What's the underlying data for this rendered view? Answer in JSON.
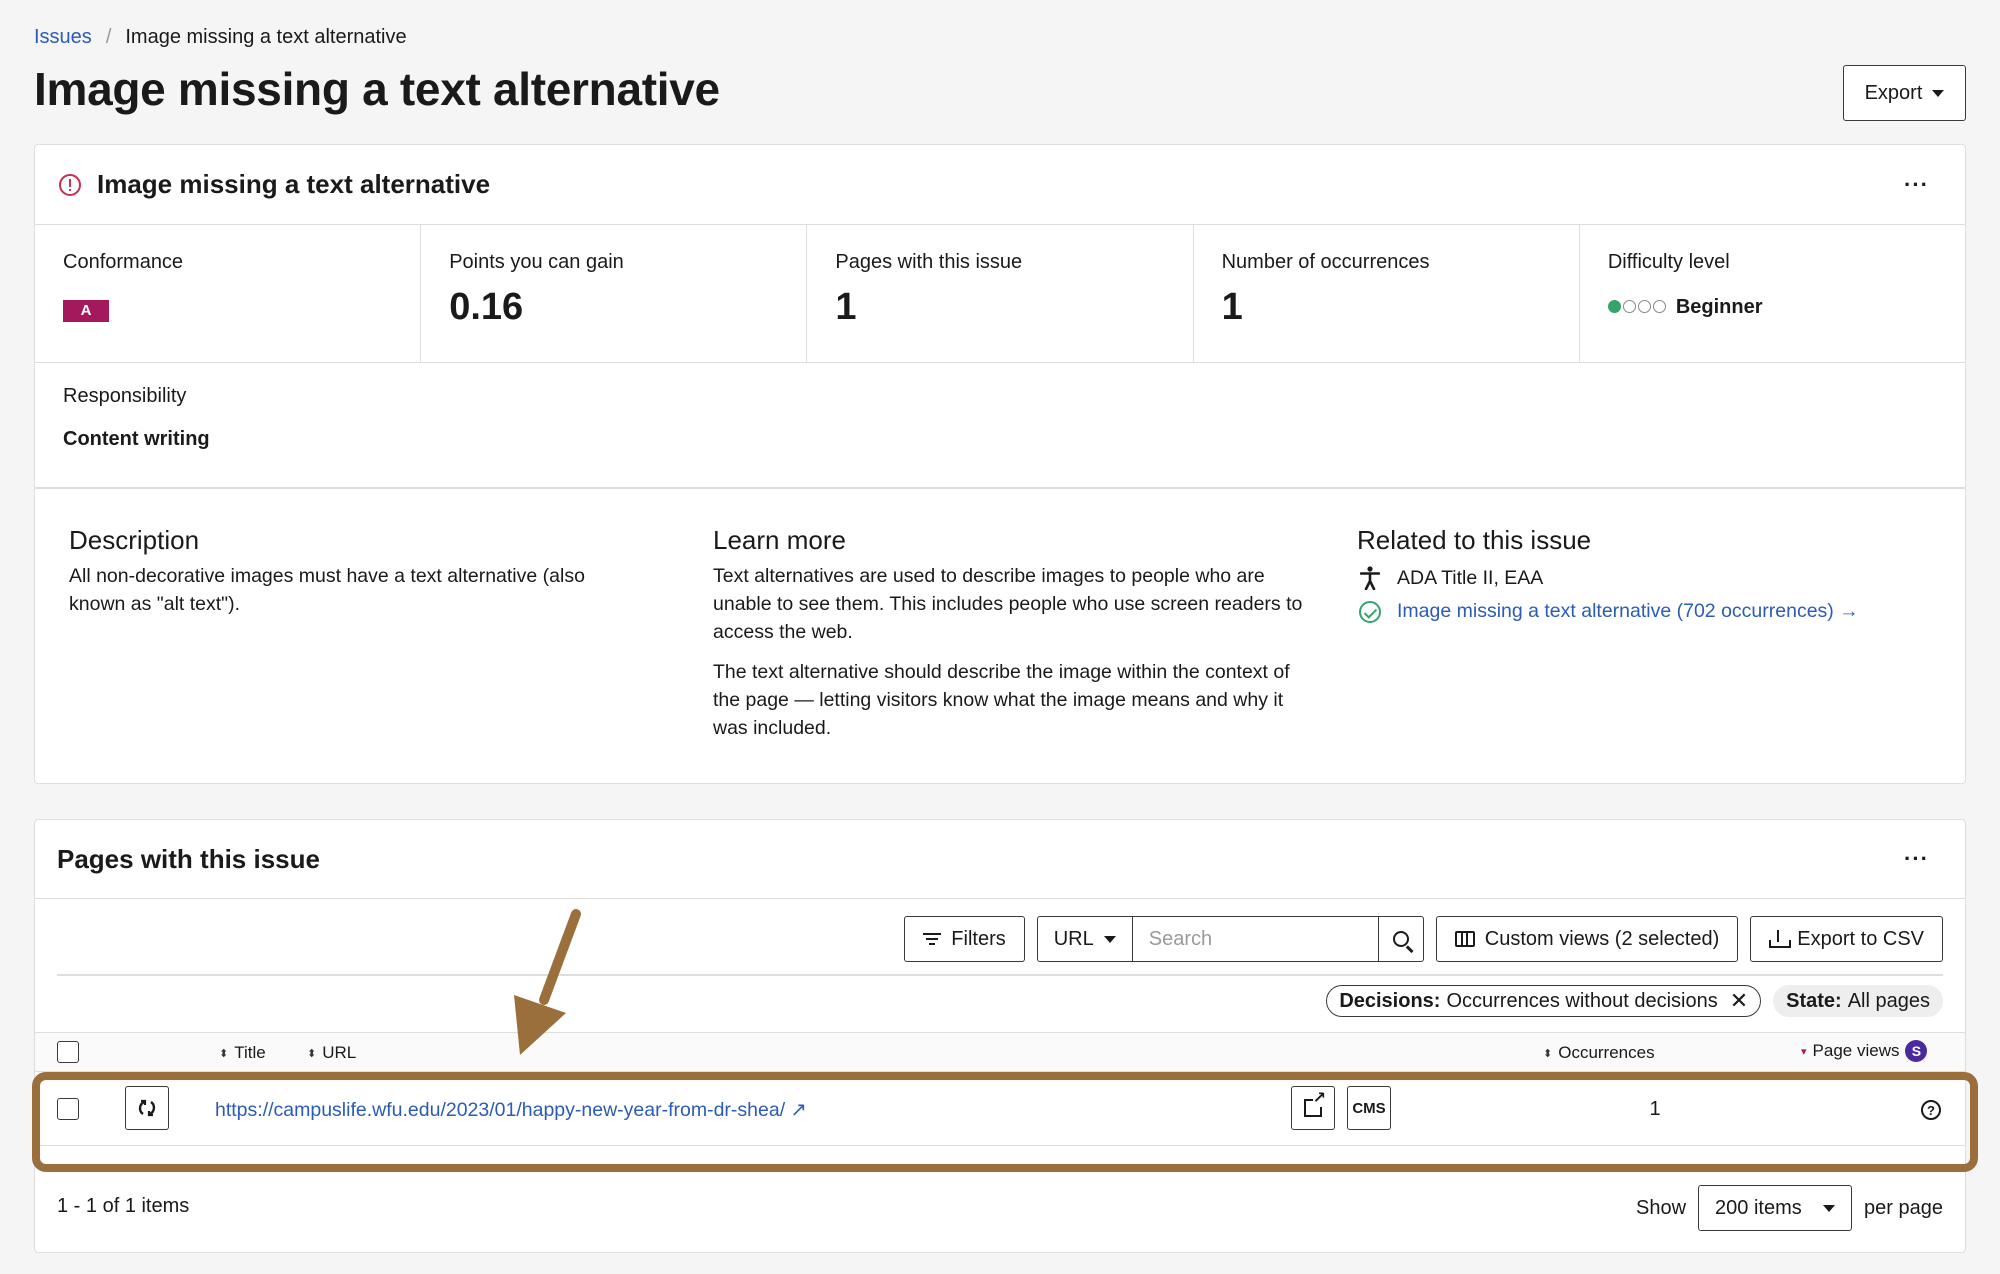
{
  "breadcrumb": {
    "parent": "Issues",
    "separator": "/",
    "current": "Image missing a text alternative"
  },
  "page_title": "Image missing a text alternative",
  "export_button": "Export",
  "issue_card": {
    "title": "Image missing a text alternative",
    "more_label": "···",
    "metrics": {
      "conformance": {
        "label": "Conformance",
        "value": "A"
      },
      "points": {
        "label": "Points you can gain",
        "value": "0.16"
      },
      "pages": {
        "label": "Pages with this issue",
        "value": "1"
      },
      "occurrences": {
        "label": "Number of occurrences",
        "value": "1"
      },
      "difficulty": {
        "label": "Difficulty level",
        "value": "Beginner",
        "level": 1,
        "max": 4
      }
    },
    "responsibility": {
      "label": "Responsibility",
      "value": "Content writing"
    },
    "description": {
      "heading": "Description",
      "text": "All non-decorative images must have a text alternative (also known as \"alt text\")."
    },
    "learn_more": {
      "heading": "Learn more",
      "p1": "Text alternatives are used to describe images to people who are unable to see them. This includes people who use screen readers to access the web.",
      "p2": "The text alternative should describe the image within the context of the page — letting visitors know what the image means and why it was included."
    },
    "related": {
      "heading": "Related to this issue",
      "standards": "ADA Title II, EAA",
      "link": "Image missing a text alternative (702 occurrences) →"
    }
  },
  "pages_card": {
    "title": "Pages with this issue",
    "more_label": "···",
    "toolbar": {
      "filters": "Filters",
      "url_select": "URL",
      "search_placeholder": "Search",
      "custom_views": "Custom views (2 selected)",
      "export_csv": "Export to CSV"
    },
    "chips": {
      "decisions_label": "Decisions:",
      "decisions_value": "Occurrences without decisions",
      "state_label": "State:",
      "state_value": "All pages"
    },
    "columns": {
      "title": "Title",
      "url": "URL",
      "occurrences": "Occurrences",
      "page_views": "Page views",
      "page_views_badge": "S"
    },
    "rows": [
      {
        "url": "https://campuslife.wfu.edu/2023/01/happy-new-year-from-dr-shea/ ↗",
        "cms": "CMS",
        "occurrences": "1"
      }
    ],
    "footer": {
      "range": "1 - 1 of 1 items",
      "show": "Show",
      "page_size": "200 items",
      "per_page": "per page"
    }
  },
  "colors": {
    "accent_link": "#2b5bb5",
    "conformance_badge": "#a3195b",
    "annotation": "#9a6f3b",
    "success": "#36a46a",
    "error": "#c6304d"
  }
}
